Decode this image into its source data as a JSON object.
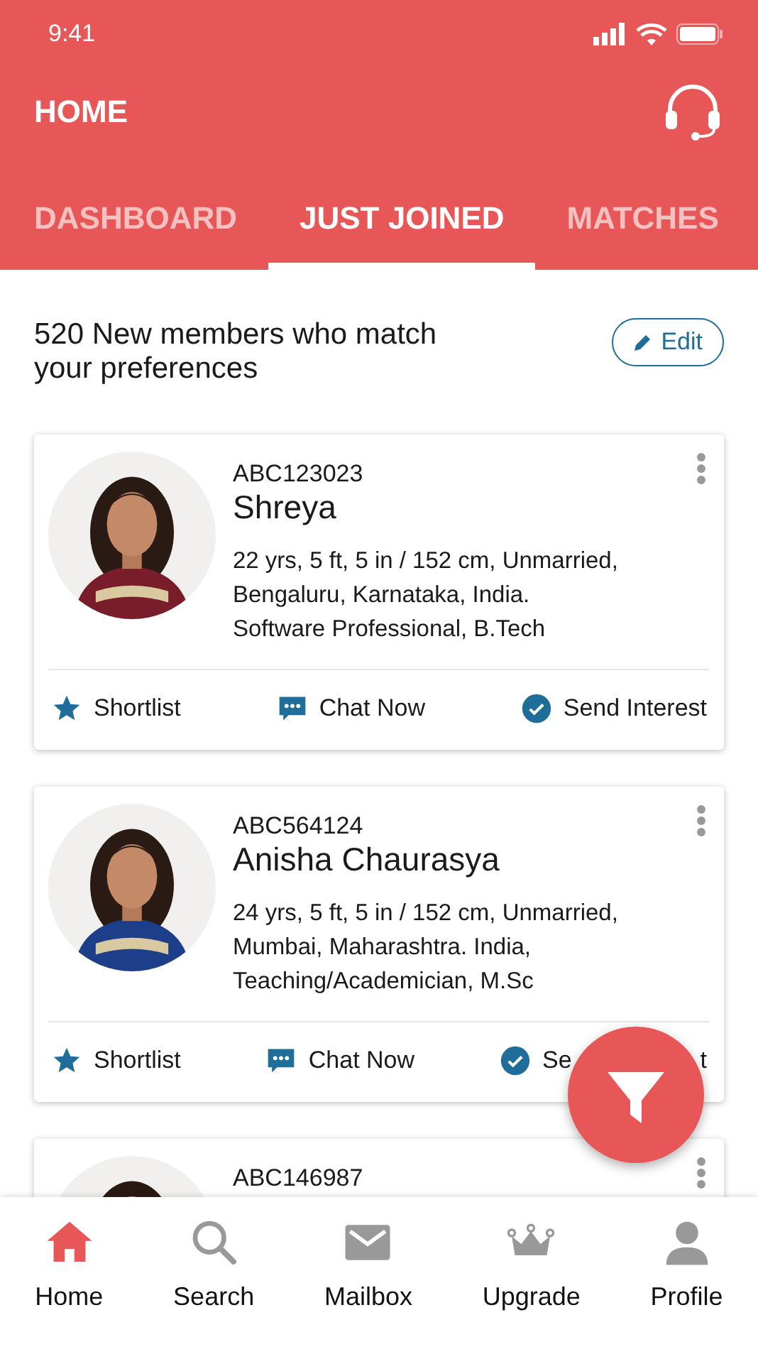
{
  "status_bar": {
    "time": "9:41"
  },
  "header": {
    "title": "HOME"
  },
  "tabs": [
    {
      "label": "DASHBOARD",
      "selected": false
    },
    {
      "label": "JUST JOINED",
      "selected": true
    },
    {
      "label": "MATCHES",
      "selected": false
    }
  ],
  "intro": {
    "text": "520 New members who match your preferences",
    "edit_button": "Edit"
  },
  "profiles": [
    {
      "id": "ABC123023",
      "name": "Shreya",
      "details": "22 yrs, 5 ft, 5 in / 152 cm, Unmarried, Bengaluru, Karnataka, India. Software Professional, B.Tech",
      "actions": [
        {
          "label": "Shortlist"
        },
        {
          "label": "Chat Now"
        },
        {
          "label": "Send Interest"
        }
      ]
    },
    {
      "id": "ABC564124",
      "name": "Anisha Chaurasya",
      "details": "24 yrs, 5 ft, 5 in / 152 cm, Unmarried, Mumbai, Maharashtra. India, Teaching/Academician, M.Sc",
      "actions": [
        {
          "label": "Shortlist"
        },
        {
          "label": "Chat Now"
        },
        {
          "label": "Se",
          "tail": "t"
        }
      ]
    },
    {
      "id": "ABC146987"
    }
  ],
  "bottom_nav": [
    {
      "label": "Home",
      "selected": true
    },
    {
      "label": "Search",
      "selected": false
    },
    {
      "label": "Mailbox",
      "selected": false
    },
    {
      "label": "Upgrade",
      "selected": false
    },
    {
      "label": "Profile",
      "selected": false
    }
  ]
}
